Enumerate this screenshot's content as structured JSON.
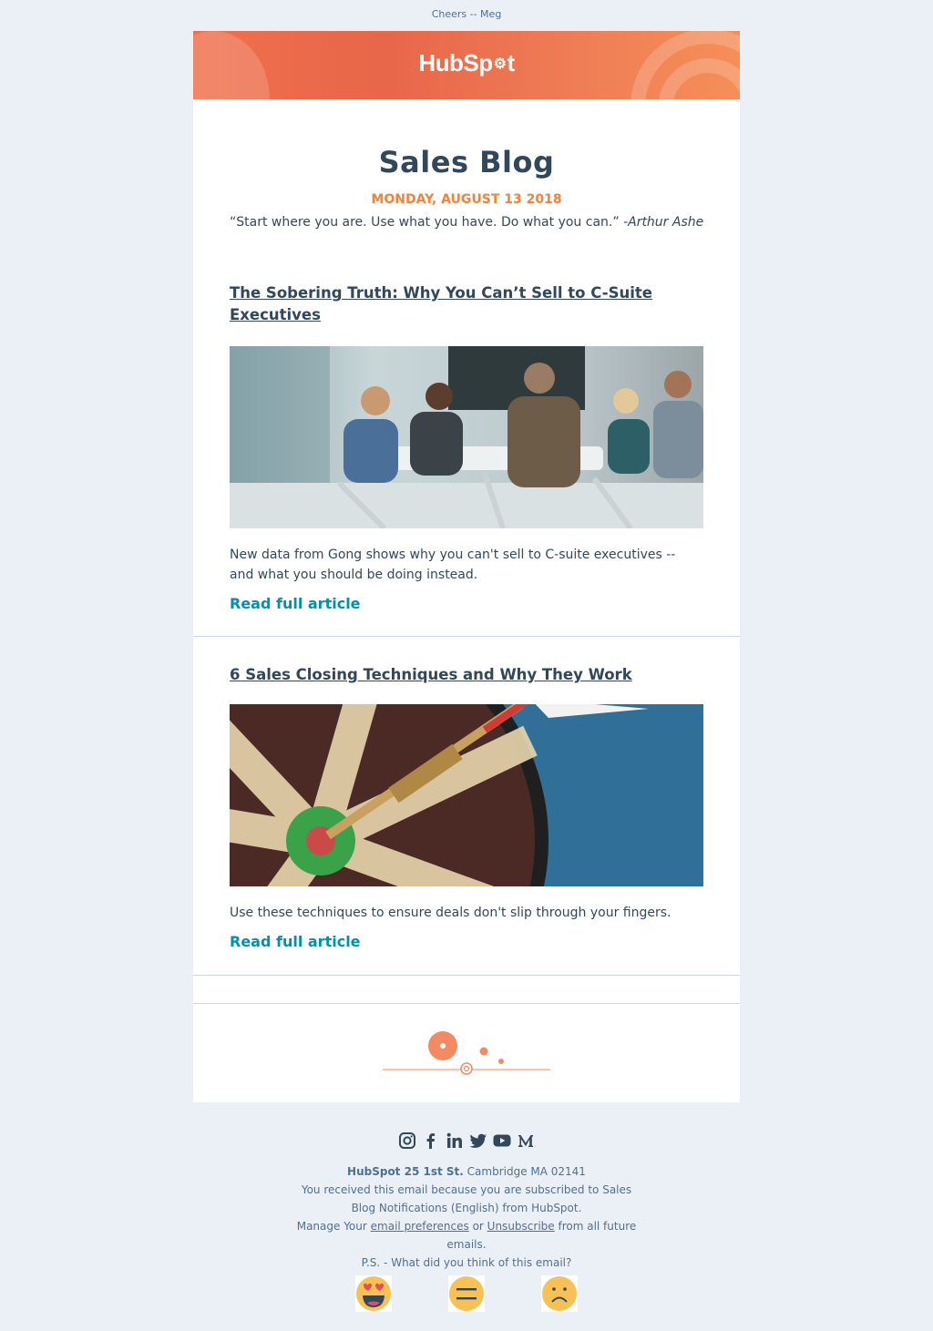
{
  "preheader": "Cheers -- Meg",
  "brand": {
    "logo_text": "HubSpot",
    "accent": "#f5813a",
    "link_color": "#0091ae",
    "banner_color": "#e8664a"
  },
  "intro": {
    "title": "Sales Blog",
    "date": "MONDAY, AUGUST 13 2018",
    "quote": "“Start where you are. Use what you have. Do what you can.”",
    "quote_author": "-Arthur Ashe"
  },
  "articles": [
    {
      "title": "The Sobering Truth: Why You Can’t Sell to C-Suite Executives",
      "image": "business-meeting-photo",
      "summary": "New data from Gong shows why you can't sell to C-suite executives -- and what you should be doing instead.",
      "cta": "Read full article"
    },
    {
      "title": "6 Sales Closing Techniques and Why They Work",
      "image": "dart-bullseye-photo",
      "summary": "Use these techniques to ensure deals don't slip through your fingers.",
      "cta": "Read full article"
    }
  ],
  "footer": {
    "social_icons": [
      "instagram-icon",
      "facebook-icon",
      "linkedin-icon",
      "twitter-icon",
      "youtube-icon",
      "medium-icon"
    ],
    "company": "HubSpot 25 1st St.",
    "city": "Cambridge MA 02141",
    "received_line1": "You received this email because you are subscribed to Sales",
    "received_line2": "Blog Notifications (English) from HubSpot.",
    "manage_prefix": "Manage Your",
    "preferences_link": "email preferences",
    "or": "or",
    "unsubscribe_link": "Unsubscribe",
    "manage_suffix1": "from all future",
    "manage_suffix2": "emails.",
    "ps": "P.S. - What did you think of this email?",
    "feedback": [
      "heart-eyes-face-icon",
      "neutral-face-icon",
      "frowning-face-icon"
    ]
  }
}
